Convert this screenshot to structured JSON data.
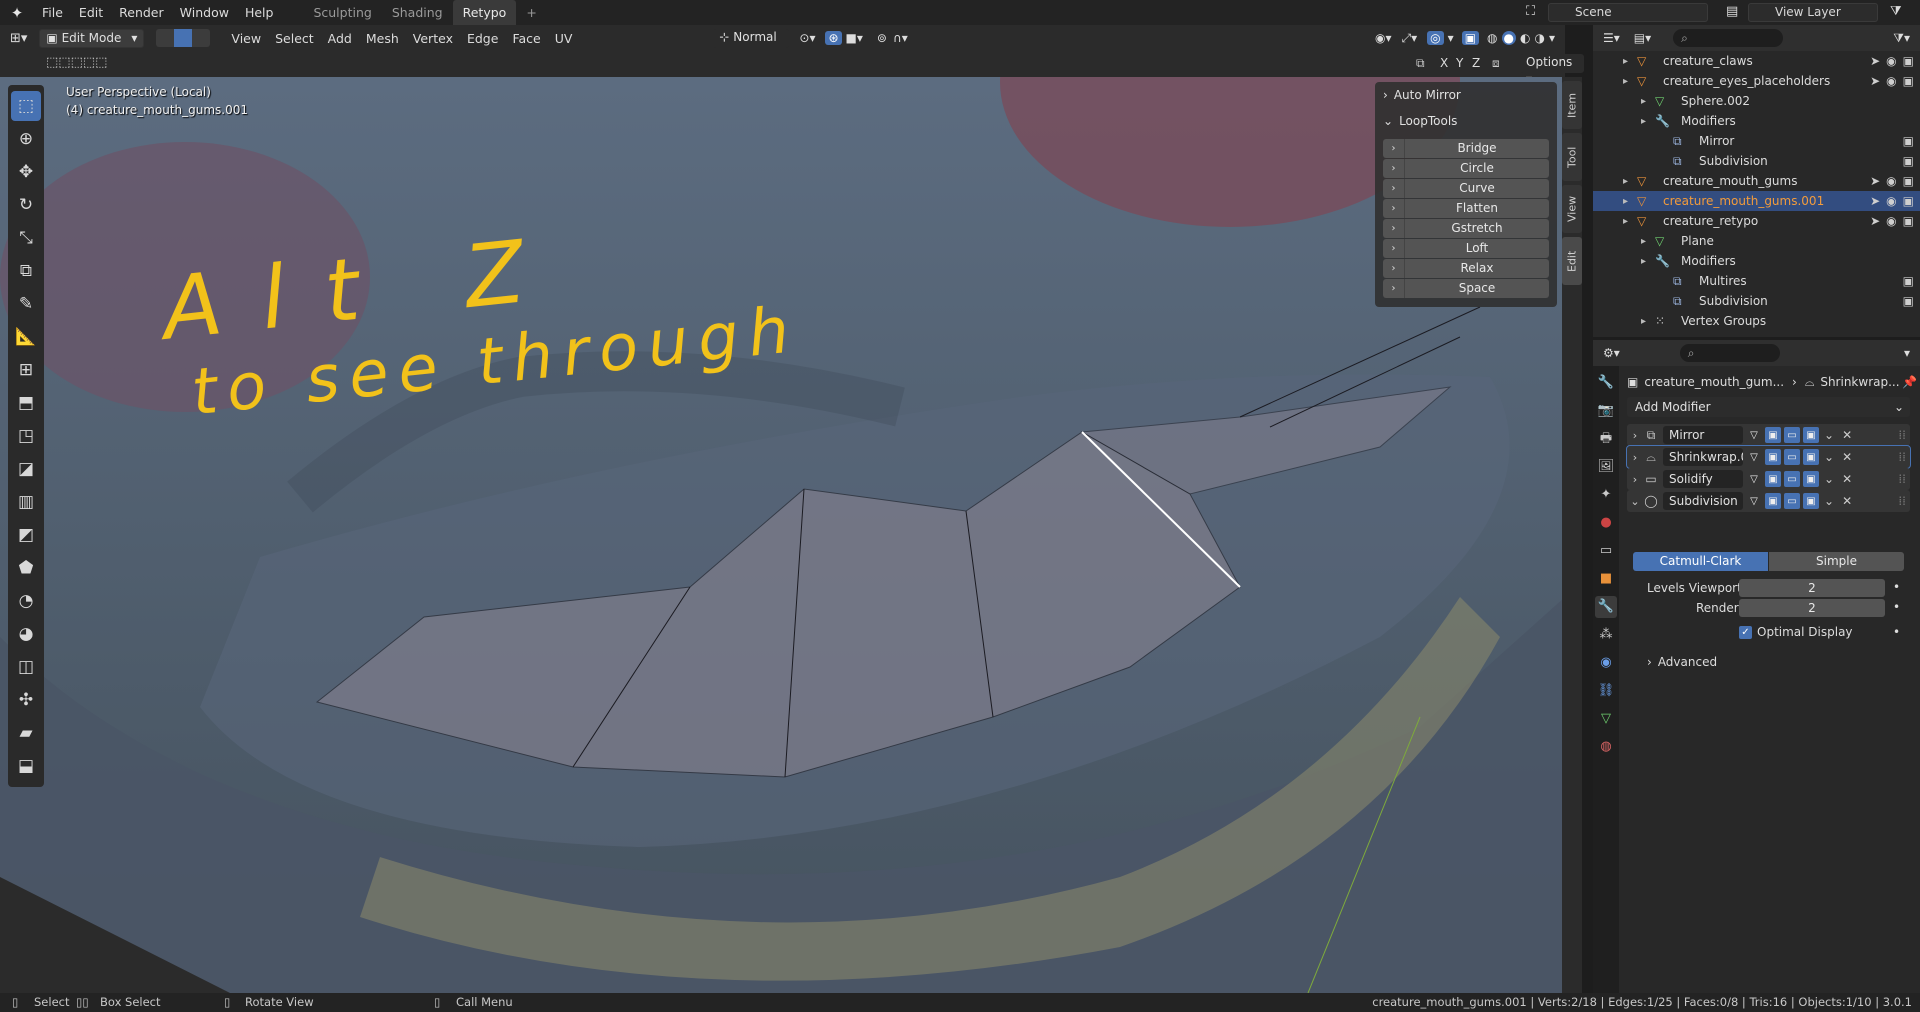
{
  "topbar": {
    "menus": [
      "File",
      "Edit",
      "Render",
      "Window",
      "Help"
    ],
    "workspaces": [
      {
        "label": "Sculpting",
        "active": false
      },
      {
        "label": "Shading",
        "active": false
      },
      {
        "label": "Retypo",
        "active": true
      }
    ],
    "add_tab": "+",
    "scene": "Scene",
    "view_layer": "View Layer"
  },
  "viewport_header": {
    "mode": "Edit Mode",
    "menus": [
      "View",
      "Select",
      "Add",
      "Mesh",
      "Vertex",
      "Edge",
      "Face",
      "UV"
    ],
    "orientation": "Normal",
    "axes": [
      "X",
      "Y",
      "Z"
    ],
    "options": "Options"
  },
  "viewport": {
    "perspective": "User Perspective (Local)",
    "object_label": "(4) creature_mouth_gums.001",
    "annotation_lines": [
      "Alt Z",
      "to see through"
    ],
    "annotation_color": "#f2c21a"
  },
  "npanel": {
    "auto_mirror": "Auto Mirror",
    "looptools": "LoopTools",
    "buttons": [
      "Bridge",
      "Circle",
      "Curve",
      "Flatten",
      "Gstretch",
      "Loft",
      "Relax",
      "Space"
    ],
    "tabs": [
      "Item",
      "Tool",
      "View",
      "Edit"
    ]
  },
  "outliner": {
    "rows": [
      {
        "label": "creature_claws",
        "indent": 1,
        "type": "mesh",
        "selected": false
      },
      {
        "label": "creature_eyes_placeholders",
        "indent": 1,
        "type": "mesh",
        "selected": false
      },
      {
        "label": "Sphere.002",
        "indent": 2,
        "type": "data",
        "selected": false
      },
      {
        "label": "Modifiers",
        "indent": 2,
        "type": "wrench",
        "selected": false
      },
      {
        "label": "Mirror",
        "indent": 3,
        "type": "mod",
        "selected": false
      },
      {
        "label": "Subdivision",
        "indent": 3,
        "type": "mod",
        "selected": false
      },
      {
        "label": "creature_mouth_gums",
        "indent": 1,
        "type": "mesh",
        "selected": false
      },
      {
        "label": "creature_mouth_gums.001",
        "indent": 1,
        "type": "mesh",
        "selected": true
      },
      {
        "label": "creature_retypo",
        "indent": 1,
        "type": "mesh",
        "selected": false
      },
      {
        "label": "Plane",
        "indent": 2,
        "type": "data",
        "selected": false
      },
      {
        "label": "Modifiers",
        "indent": 2,
        "type": "wrench",
        "selected": false
      },
      {
        "label": "Multires",
        "indent": 3,
        "type": "mod",
        "selected": false
      },
      {
        "label": "Subdivision",
        "indent": 3,
        "type": "mod",
        "selected": false
      },
      {
        "label": "Vertex Groups",
        "indent": 2,
        "type": "group",
        "selected": false
      }
    ]
  },
  "properties": {
    "breadcrumb_object": "creature_mouth_gum...",
    "breadcrumb_modifier": "Shrinkwrap...",
    "add_modifier": "Add Modifier",
    "modifiers": [
      "Mirror",
      "Shrinkwrap.0...",
      "Solidify",
      "Subdivision"
    ],
    "subdivision": {
      "algorithm_options": [
        "Catmull-Clark",
        "Simple"
      ],
      "selected_algorithm": "Catmull-Clark",
      "levels_viewport_label": "Levels Viewport",
      "levels_viewport": "2",
      "render_label": "Render",
      "render": "2",
      "optimal_display_label": "Optimal Display",
      "optimal_display": true,
      "advanced": "Advanced"
    }
  },
  "statusbar": {
    "select": "Select",
    "box_select": "Box Select",
    "rotate_view": "Rotate View",
    "call_menu": "Call Menu",
    "stats": "creature_mouth_gums.001 | Verts:2/18 | Edges:1/25 | Faces:0/8 | Tris:16 | Objects:1/10 | 3.0.1"
  },
  "colors": {
    "accent": "#4772b3",
    "selected_object_text": "#f39c3c"
  }
}
